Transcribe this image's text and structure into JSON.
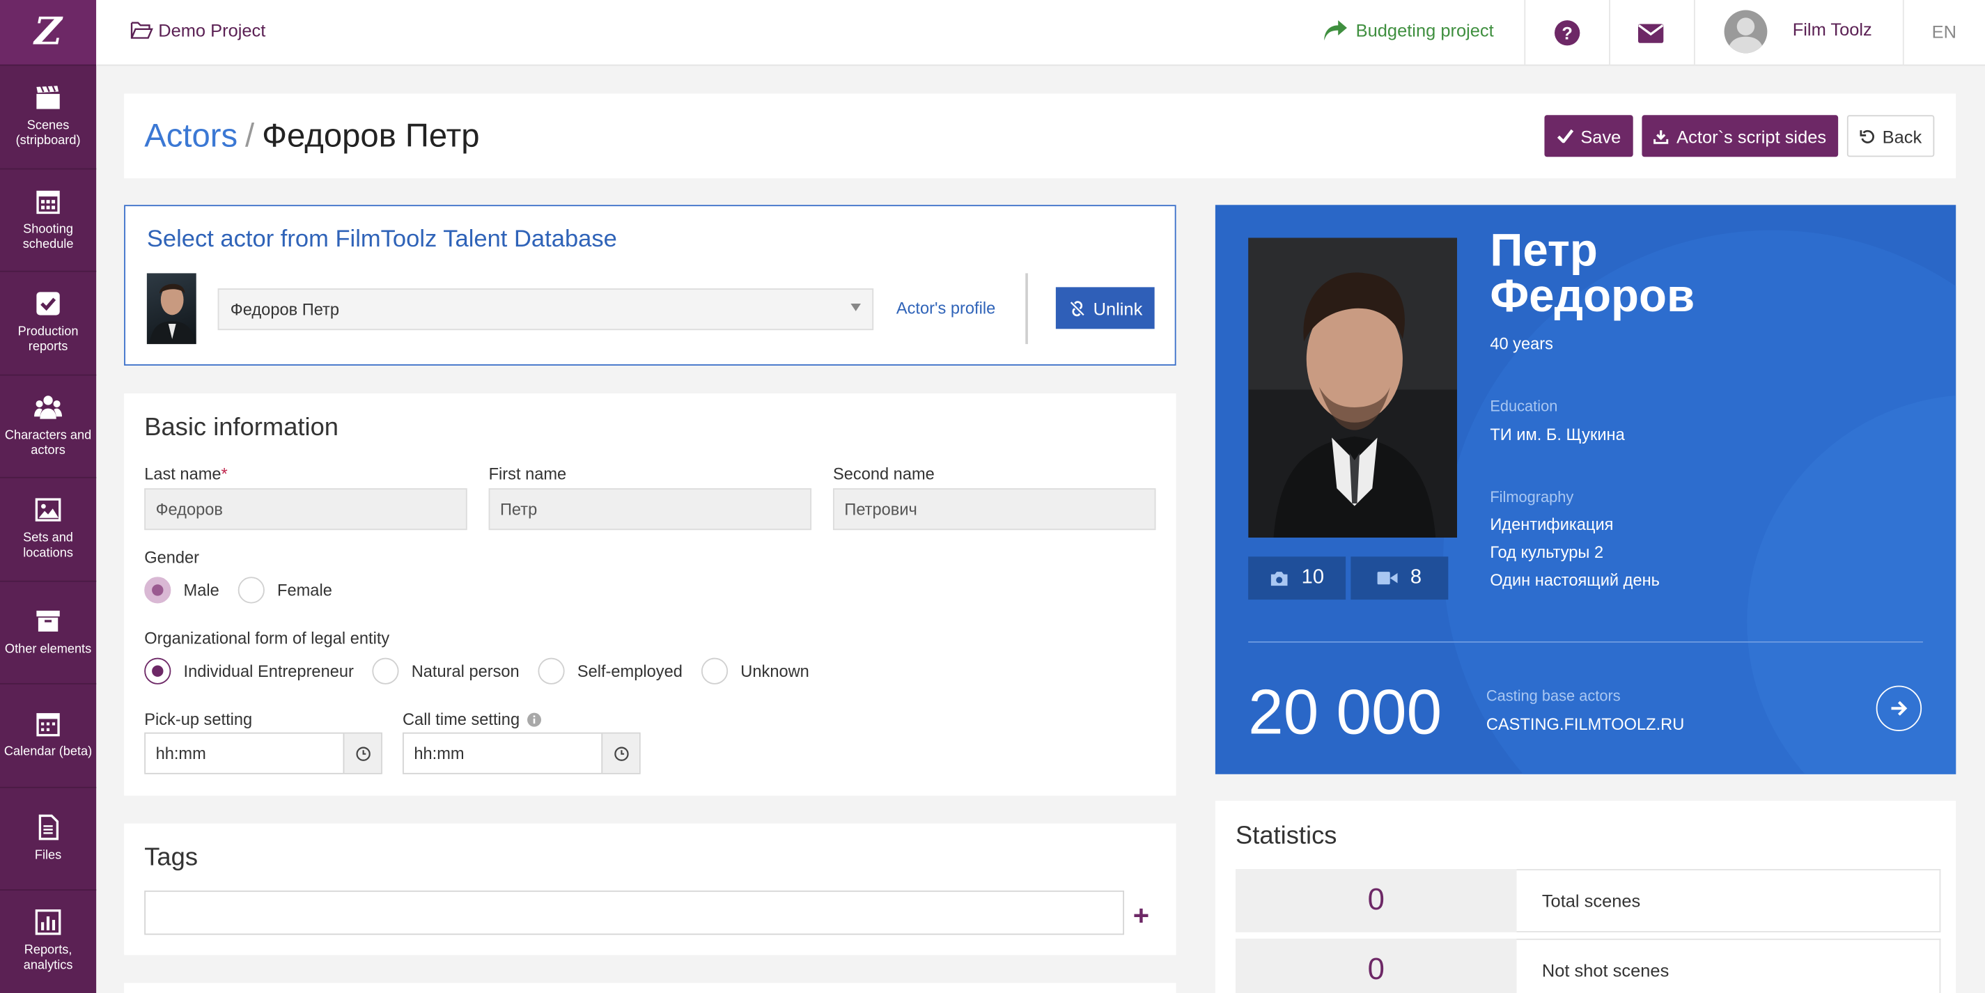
{
  "app": {
    "logo": "Z"
  },
  "sidebar": {
    "items": [
      {
        "label": "Scenes (stripboard)",
        "icon": "clapperboard-icon"
      },
      {
        "label": "Shooting schedule",
        "icon": "calendar-grid-icon"
      },
      {
        "label": "Production reports",
        "icon": "checkbox-icon"
      },
      {
        "label": "Characters and actors",
        "icon": "users-icon"
      },
      {
        "label": "Sets and locations",
        "icon": "image-icon"
      },
      {
        "label": "Other elements",
        "icon": "archive-icon"
      },
      {
        "label": "Calendar (beta)",
        "icon": "calendar-icon"
      },
      {
        "label": "Files",
        "icon": "file-icon"
      },
      {
        "label": "Reports, analytics",
        "icon": "bar-chart-icon"
      }
    ]
  },
  "topbar": {
    "project": "Demo Project",
    "budgeting": "Budgeting project",
    "user": "Film Toolz",
    "lang": "EN"
  },
  "header": {
    "crumb_root": "Actors",
    "crumb_sep": "/",
    "crumb_current": "Федоров Петр",
    "save": "Save",
    "script_sides": "Actor`s script sides",
    "back": "Back"
  },
  "select_actor": {
    "title": "Select actor from FilmToolz Talent Database",
    "selected": "Федоров Петр",
    "profile_link": "Actor's profile",
    "unlink": "Unlink"
  },
  "basic": {
    "title": "Basic information",
    "last_name_label": "Last name",
    "required_mark": "*",
    "last_name": "Федоров",
    "first_name_label": "First name",
    "first_name": "Петр",
    "second_name_label": "Second name",
    "second_name": "Петрович",
    "gender_label": "Gender",
    "gender_options": [
      "Male",
      "Female"
    ],
    "gender_selected": "Male",
    "org_label": "Organizational form of legal entity",
    "org_options": [
      "Individual Entrepreneur",
      "Natural person",
      "Self-employed",
      "Unknown"
    ],
    "org_selected": "Individual Entrepreneur",
    "pickup_label": "Pick-up setting",
    "pickup_value": "hh:mm",
    "calltime_label": "Call time setting",
    "calltime_value": "hh:mm"
  },
  "tags": {
    "title": "Tags"
  },
  "profile": {
    "name_line1": "Петр",
    "name_line2": "Федоров",
    "age": "40 years",
    "education_label": "Education",
    "education": "ТИ им. Б. Щукина",
    "filmography_label": "Filmography",
    "filmography": [
      "Идентификация",
      "Год культуры 2",
      "Один настоящий день"
    ],
    "photos_count": "10",
    "videos_count": "8",
    "casting_count": "20 000",
    "casting_label": "Casting base actors",
    "casting_site": "CASTING.FILMTOOLZ.RU"
  },
  "statistics": {
    "title": "Statistics",
    "rows": [
      {
        "value": "0",
        "label": "Total scenes"
      },
      {
        "value": "0",
        "label": "Not shot scenes"
      }
    ]
  },
  "colors": {
    "brand": "#5b2154",
    "accent_blue": "#2a67c7",
    "link": "#3b78d4",
    "success": "#3f8f3f"
  }
}
